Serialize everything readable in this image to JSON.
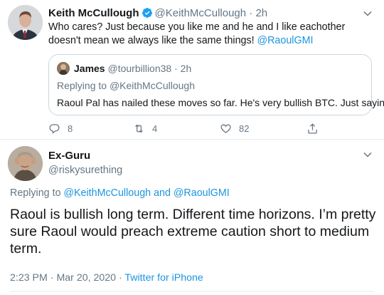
{
  "tweet": {
    "author_name": "Keith McCullough",
    "author_handle": "@KeithMcCullough",
    "separator": "·",
    "time": "2h",
    "text": "Who cares? Just because you like me and he and I like eachother doesn't mean we always like the same things! ",
    "mention": "@RaoulGMI",
    "quoted": {
      "author_name": "James",
      "author_handle": "@tourbillion38",
      "separator": "·",
      "time": "2h",
      "replying_prefix": "Replying to ",
      "replying_to": "@KeithMcCullough",
      "text": "Raoul Pal has nailed these moves so far. He's very bullish BTC. Just sayin’"
    },
    "actions": {
      "replies": "8",
      "retweets": "4",
      "likes": "82"
    }
  },
  "reply": {
    "author_name": "Ex-Guru",
    "author_handle": "@riskysurething",
    "replying_prefix": "Replying to ",
    "replying_to_1": "@KeithMcCullough",
    "replying_and": " and ",
    "replying_to_2": "@RaoulGMI",
    "text": "Raoul is bullish long term. Different time horizons. I’m pretty sure Raoul would preach extreme caution short to medium term.",
    "timestamp": "2:23 PM · Mar 20, 2020",
    "separator": " · ",
    "source": "Twitter for iPhone"
  },
  "colors": {
    "link": "#1b95e0",
    "muted": "#657786",
    "verified": "#1da1f2"
  },
  "icons": [
    "verified-badge-icon",
    "chevron-down-icon",
    "reply-icon",
    "retweet-icon",
    "like-icon",
    "share-icon"
  ]
}
